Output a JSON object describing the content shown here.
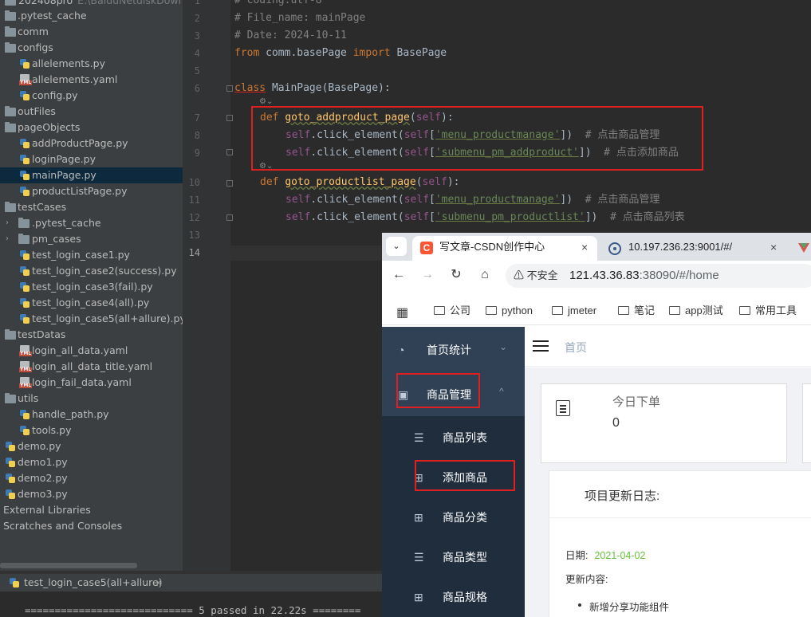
{
  "tree": {
    "items": [
      {
        "label": "202408pro",
        "path": "E:\\BaiduNetdiskDownload",
        "icon": "folder-icon"
      },
      {
        "label": ".pytest_cache",
        "icon": "folder-icon"
      },
      {
        "label": "comm",
        "icon": "folder-icon"
      },
      {
        "label": "configs",
        "icon": "folder-icon"
      },
      {
        "label": "allelements.py",
        "icon": "python-file-icon"
      },
      {
        "label": "allelements.yaml",
        "icon": "yaml-file-icon"
      },
      {
        "label": "config.py",
        "icon": "python-file-icon"
      },
      {
        "label": "outFiles",
        "icon": "folder-icon"
      },
      {
        "label": "pageObjects",
        "icon": "folder-icon"
      },
      {
        "label": "addProductPage.py",
        "icon": "python-file-icon"
      },
      {
        "label": "loginPage.py",
        "icon": "python-file-icon"
      },
      {
        "label": "mainPage.py",
        "icon": "python-file-icon"
      },
      {
        "label": "productListPage.py",
        "icon": "python-file-icon"
      },
      {
        "label": "testCases",
        "icon": "folder-icon"
      },
      {
        "label": ".pytest_cache",
        "icon": "folder-icon"
      },
      {
        "label": "pm_cases",
        "icon": "folder-icon"
      },
      {
        "label": "test_login_case1.py",
        "icon": "python-file-icon"
      },
      {
        "label": "test_login_case2(success).py",
        "icon": "python-file-icon"
      },
      {
        "label": "test_login_case3(fail).py",
        "icon": "python-file-icon"
      },
      {
        "label": "test_login_case4(all).py",
        "icon": "python-file-icon"
      },
      {
        "label": "test_login_case5(all+allure).py",
        "icon": "python-file-icon"
      },
      {
        "label": "testDatas",
        "icon": "folder-icon"
      },
      {
        "label": "login_all_data.yaml",
        "icon": "yaml-file-icon"
      },
      {
        "label": "login_all_data_title.yaml",
        "icon": "yaml-file-icon"
      },
      {
        "label": "login_fail_data.yaml",
        "icon": "yaml-file-icon"
      },
      {
        "label": "utils",
        "icon": "folder-icon"
      },
      {
        "label": "handle_path.py",
        "icon": "python-file-icon"
      },
      {
        "label": "tools.py",
        "icon": "python-file-icon"
      },
      {
        "label": "demo.py",
        "icon": "python-file-icon"
      },
      {
        "label": "demo1.py",
        "icon": "python-file-icon"
      },
      {
        "label": "demo2.py",
        "icon": "python-file-icon"
      },
      {
        "label": "demo3.py",
        "icon": "python-file-icon"
      },
      {
        "label": "External Libraries",
        "icon": ""
      },
      {
        "label": "Scratches and Consoles",
        "icon": ""
      }
    ],
    "selected": "mainPage.py"
  },
  "editor": {
    "line_numbers": [
      "1",
      "2",
      "3",
      "4",
      "5",
      "6",
      "7",
      "8",
      "9",
      "10",
      "11",
      "12",
      "13",
      "14"
    ],
    "l1": "# coding:utf-8",
    "l2": "# File_name: mainPage",
    "l3": "# Date: 2024-10-11",
    "l4_from": "from",
    "l4_mod": " comm.basePage ",
    "l4_import": "import",
    "l4_cls": " BasePage",
    "l6_class": "class",
    "l6_rest": " MainPage(BasePage):",
    "l7_def": "def",
    "l7_name": "goto_addproduct_page",
    "l7_args": "(",
    "l7_self": "self",
    "l7_end": "):",
    "l8_self": "self",
    "l8_call": ".click_element(",
    "l8_self2": "self",
    "l8_key": "'menu_productmanage'",
    "l8_end": "])",
    "l8_cm": "  # 点击商品管理",
    "l9_self": "self",
    "l9_call": ".click_element(",
    "l9_self2": "self",
    "l9_key": "'submenu_pm_addproduct'",
    "l9_end": "])",
    "l9_cm": "  # 点击添加商品",
    "l10_def": "def",
    "l10_name": "goto_productlist_page",
    "l10_args": "(",
    "l10_self": "self",
    "l10_end": "):",
    "l11_self": "self",
    "l11_call": ".click_element(",
    "l11_self2": "self",
    "l11_key": "'menu_productmanage'",
    "l11_end": "])",
    "l11_cm": "  # 点击商品管理",
    "l12_self": "self",
    "l12_call": ".click_element(",
    "l12_self2": "self",
    "l12_key": "'submenu_pm_productlist'",
    "l12_end": "])",
    "l12_cm": "  # 点击商品列表"
  },
  "run": {
    "tab_label": "test_login_case5(all+allure)",
    "close": "×",
    "output": "============================ 5 passed in 22.22s ========"
  },
  "browser": {
    "tabs": [
      {
        "label": "写文章-CSDN创作中心",
        "icon": "csdn-icon",
        "close": "×"
      },
      {
        "label": "10.197.236.23:9001/#/",
        "icon": "react-icon",
        "close": "×"
      }
    ],
    "insecure_label": "⚠ 不安全",
    "url_host": "121.43.36.83",
    "url_rest": ":38090/#/home",
    "bookmarks": [
      "公司",
      "python",
      "jmeter",
      "笔记",
      "app测试",
      "常用工具"
    ]
  },
  "app": {
    "menu": [
      {
        "label": "首页统计",
        "icon": "dashboard-icon",
        "chevron": "⌄"
      },
      {
        "label": "商品管理",
        "icon": "chart-icon",
        "chevron": "^"
      }
    ],
    "submenu": [
      {
        "label": "商品列表",
        "icon": "list-icon"
      },
      {
        "label": "添加商品",
        "icon": "add-icon"
      },
      {
        "label": "商品分类",
        "icon": "grid-icon"
      },
      {
        "label": "商品类型",
        "icon": "list-icon"
      },
      {
        "label": "商品规格",
        "icon": "grid-icon"
      }
    ],
    "breadcrumb": "首页",
    "card_label": "今日下单",
    "card_value": "0",
    "log_title": "项目更新日志:",
    "log_date_label": "日期:",
    "log_date": "2021-04-02",
    "log_update_label": "更新内容:",
    "log_item": "新增分享功能组件"
  }
}
